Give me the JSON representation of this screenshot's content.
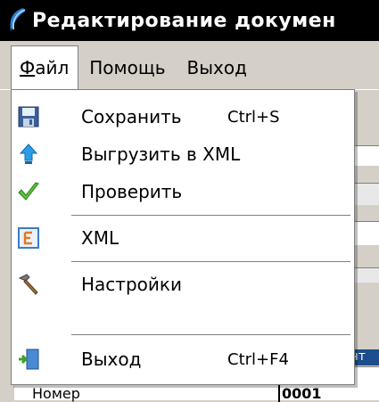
{
  "window": {
    "title": "Редактирование докумен"
  },
  "menubar": {
    "items": [
      {
        "label_ul": "Ф",
        "label_rest": "айл"
      },
      {
        "label": "Помощь"
      },
      {
        "label": "Выход"
      }
    ]
  },
  "dropdown": {
    "items": [
      {
        "label": "Сохранить",
        "shortcut": "Ctrl+S",
        "icon": "floppy-disk-icon"
      },
      {
        "label": "Выгрузить в XML",
        "shortcut": "",
        "icon": "upload-arrow-icon"
      },
      {
        "label": "Проверить",
        "shortcut": "",
        "icon": "checkmark-icon"
      },
      {
        "label": "XML",
        "shortcut": "",
        "icon": "xml-tree-icon"
      },
      {
        "label": "Настройки",
        "shortcut": "",
        "icon": "hammer-icon"
      },
      {
        "label": "Выход",
        "shortcut": "Ctrl+F4",
        "icon": "exit-door-icon"
      }
    ]
  },
  "background": {
    "grid_label": "Номер",
    "grid_value": "0001",
    "tab_fragment": "ент"
  },
  "colors": {
    "title_bg": "#000000",
    "menu_bg": "#d4d0c8",
    "dropdown_bg": "#ffffff",
    "accent": "#1c4d8c"
  }
}
